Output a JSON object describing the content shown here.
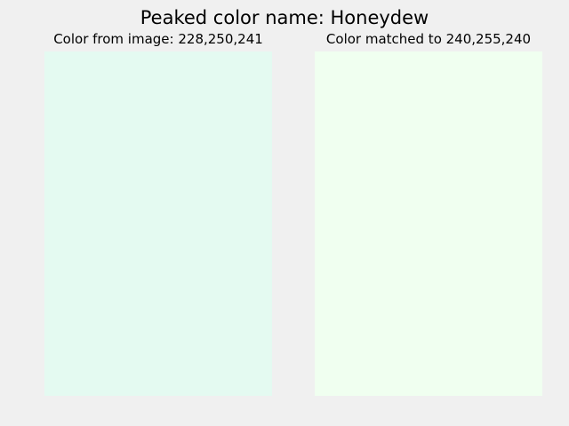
{
  "figure": {
    "title": "Peaked color name: Honeydew"
  },
  "panels": {
    "left": {
      "title": "Color from image: 228,250,241",
      "color": "#e4faf1"
    },
    "right": {
      "title": "Color matched to 240,255,240",
      "color": "#f0fff0"
    }
  }
}
